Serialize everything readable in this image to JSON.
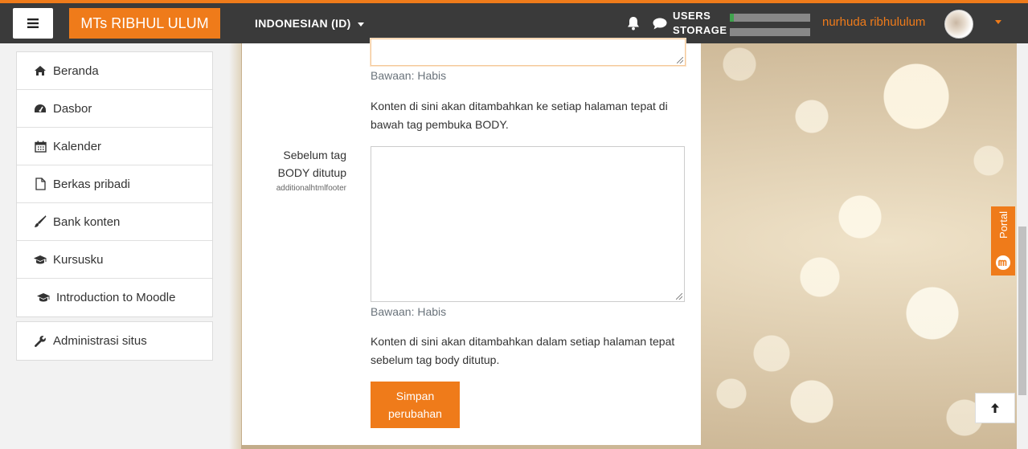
{
  "navbar": {
    "brand": "MTs RIBHUL ULUM",
    "language": "INDONESIAN (ID)",
    "users_label": "USERS",
    "storage_label": "STORAGE",
    "users_usage_fraction": 0.05,
    "storage_usage_fraction": 0.0,
    "username": "nurhuda ribhululum",
    "accent_color": "#ef7b1a",
    "icons": [
      "menu-icon",
      "bell-icon",
      "chat-icon",
      "caret-down-icon"
    ]
  },
  "drawer": {
    "items": [
      {
        "label": "Beranda",
        "icon": "home-icon"
      },
      {
        "label": "Dasbor",
        "icon": "dashboard-icon"
      },
      {
        "label": "Kalender",
        "icon": "calendar-icon"
      },
      {
        "label": "Berkas pribadi",
        "icon": "file-icon"
      },
      {
        "label": "Bank konten",
        "icon": "brush-icon"
      },
      {
        "label": "Kursusku",
        "icon": "graduation-cap-icon"
      },
      {
        "label": "Introduction to Moodle",
        "icon": "graduation-cap-icon"
      }
    ],
    "admin": {
      "label": "Administrasi situs",
      "icon": "wrench-icon"
    }
  },
  "form": {
    "top_default": "Bawaan: Habis",
    "top_description": "Konten di sini akan ditambahkan ke setiap halaman tepat di bawah tag pembuka BODY.",
    "footer_label": "Sebelum tag BODY ditutup",
    "footer_setting": "additionalhtmlfooter",
    "footer_value": "",
    "footer_default": "Bawaan: Habis",
    "footer_description": "Konten di sini akan ditambahkan dalam setiap halaman tepat sebelum tag body ditutup.",
    "save_label": "Simpan perubahan"
  },
  "side": {
    "portal_label": "Portal"
  }
}
